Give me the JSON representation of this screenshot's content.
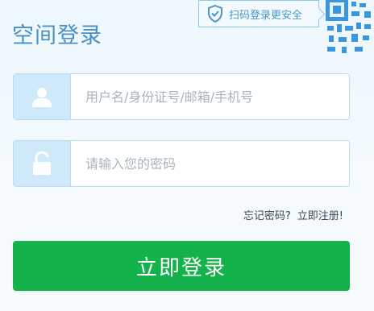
{
  "title": "空间登录",
  "qr_tip": {
    "label": "扫码登录更安全",
    "shield_icon": "shield-check-icon",
    "color": "#4b96c9"
  },
  "qr_code": {
    "icon": "qr-code-icon",
    "color": "#3c96dc"
  },
  "username": {
    "placeholder": "用户名/身份证号/邮箱/手机号",
    "value": "",
    "icon": "user-icon"
  },
  "password": {
    "placeholder": "请输入您的密码",
    "value": "",
    "icon": "unlock-icon"
  },
  "links": {
    "forgot": "忘记密码?",
    "register": "立即注册!"
  },
  "login_button": {
    "label": "立即登录",
    "color": "#14b24a"
  },
  "colors": {
    "title": "#4a8fc4",
    "icon_bg": "#cfe9fb",
    "border": "#b9dbef"
  }
}
